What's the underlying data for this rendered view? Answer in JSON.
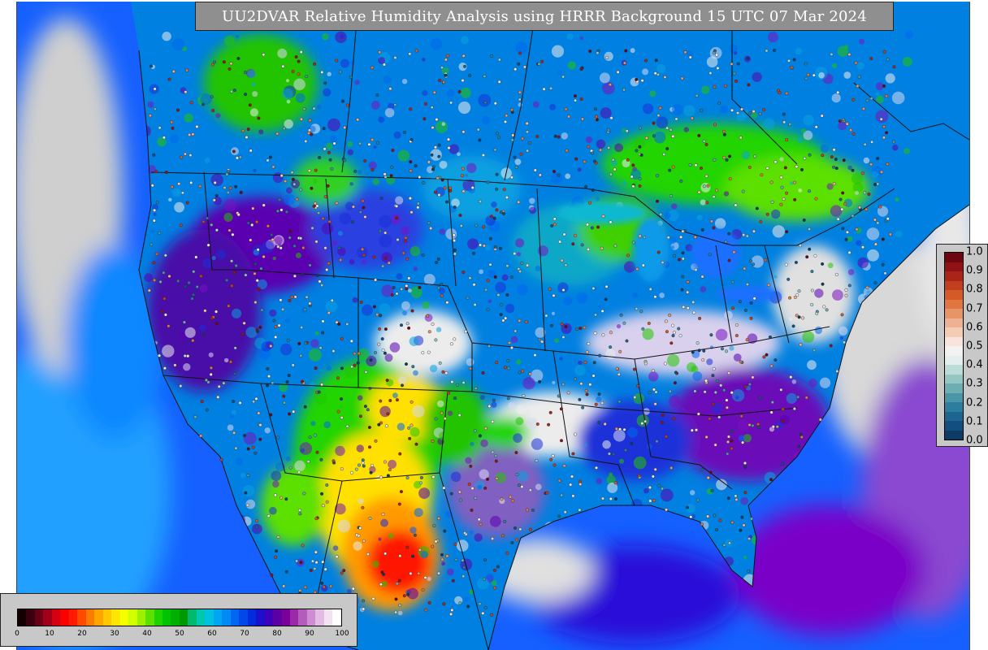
{
  "title": "UU2DVAR Relative Humidity Analysis using HRRR Background 15 UTC 07 Mar 2024",
  "colorbar_main": {
    "ticks": [
      "0",
      "10",
      "20",
      "30",
      "40",
      "50",
      "60",
      "70",
      "80",
      "90",
      "100"
    ],
    "colors": [
      "#140000",
      "#3a0010",
      "#6a0016",
      "#a00018",
      "#d40012",
      "#ff0000",
      "#ff1a00",
      "#ff4a00",
      "#ff7a00",
      "#ffa500",
      "#ffc800",
      "#ffe600",
      "#f4ff00",
      "#d2ff00",
      "#9cf000",
      "#5ce000",
      "#1ed200",
      "#00c400",
      "#00b000",
      "#009800",
      "#00b870",
      "#00c8b0",
      "#00c0e0",
      "#00a6f2",
      "#008af5",
      "#0068f0",
      "#0048e8",
      "#002cdc",
      "#1c10cc",
      "#3e00b8",
      "#5c00a6",
      "#7c0098",
      "#9a2aa8",
      "#b45cbc",
      "#cc8ed0",
      "#e2bce2",
      "#f2e2f2",
      "#ffffff"
    ]
  },
  "colorbar_obs": {
    "ticks": [
      "0.0",
      "0.1",
      "0.2",
      "0.3",
      "0.4",
      "0.5",
      "0.6",
      "0.7",
      "0.8",
      "0.9",
      "1.0"
    ],
    "colors": [
      "#0d3b66",
      "#134f7e",
      "#1e6690",
      "#2d7e9e",
      "#4896a8",
      "#6caeb2",
      "#94c6c2",
      "#bcdcd8",
      "#e4eeee",
      "#f2f2f2",
      "#f8e4da",
      "#f4cbb5",
      "#eeb193",
      "#e89469",
      "#e07640",
      "#d45a28",
      "#c23e1e",
      "#aa2418",
      "#8e1216",
      "#6e0612"
    ]
  },
  "map_colors": {
    "ocean": "#1560ff",
    "ocean_light": "#20a0ff",
    "ocean_dark": "#0028e0",
    "land": "#0080e0",
    "land_purple": "#5a00b0",
    "land_white": "#ececec",
    "green": "#22d400",
    "yellow": "#ffe000",
    "orange": "#ff9a00",
    "red": "#ff1500",
    "background": "#cfcfcf"
  }
}
